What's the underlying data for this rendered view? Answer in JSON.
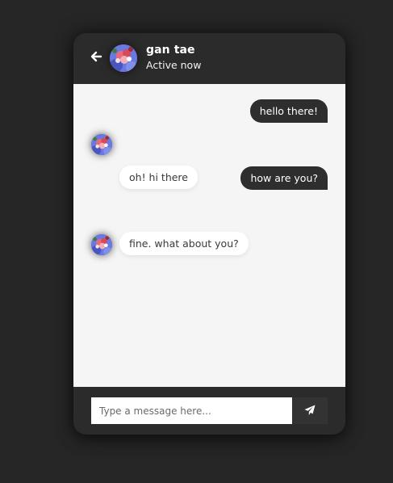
{
  "header": {
    "back_icon": "arrow-left-icon",
    "contact_name": "gan tae",
    "status": "Active now"
  },
  "messages": [
    {
      "direction": "outgoing",
      "text": "hello there!"
    },
    {
      "direction": "incoming",
      "text": "oh! hi there"
    },
    {
      "direction": "outgoing",
      "text": "how are you?"
    },
    {
      "direction": "incoming",
      "text": "fine. what about you?"
    }
  ],
  "composer": {
    "placeholder": "Type a message here...",
    "value": "",
    "send_icon": "paper-plane-icon"
  },
  "colors": {
    "page_background": "#262626",
    "header_footer": "#2b2b2b",
    "chat_background": "#f5f5f5",
    "outgoing_bubble": "#2e2e2e",
    "incoming_bubble": "#ffffff"
  }
}
